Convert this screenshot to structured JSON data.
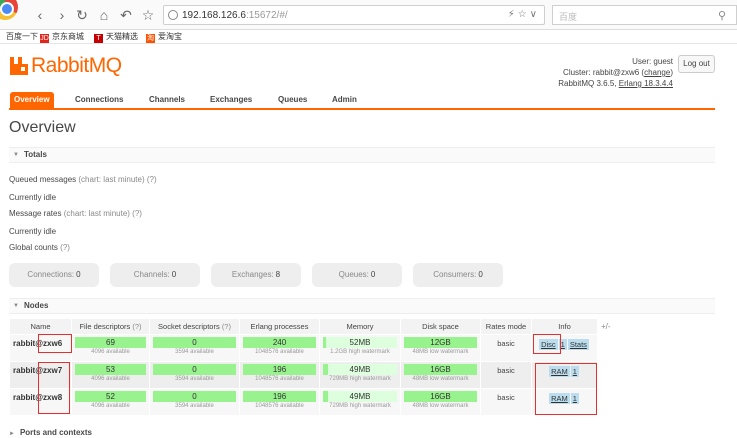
{
  "browser": {
    "url_host": "192.168.126.6",
    "url_rest": ":15672/#/",
    "search_placeholder": "百度",
    "bookmarks": [
      {
        "label": "百度一下",
        "icon": ""
      },
      {
        "label": "京东商城",
        "icon": "JD",
        "color": "#e1251b"
      },
      {
        "label": "天猫精选",
        "icon": "T",
        "color": "#c40000"
      },
      {
        "label": "爱淘宝",
        "icon": "淘",
        "color": "#ff5000"
      }
    ]
  },
  "header": {
    "logo_text": "RabbitMQ",
    "logo_tm": "TM",
    "user_line": "User: guest",
    "cluster_prefix": "Cluster: rabbit@zxw6 (",
    "cluster_link": "change",
    "cluster_suffix": ")",
    "version_prefix": "RabbitMQ 3.6.5, ",
    "erlang_link": "Erlang 18.3.4.4",
    "logout_label": "Log out"
  },
  "tabs": [
    "Overview",
    "Connections",
    "Channels",
    "Exchanges",
    "Queues",
    "Admin"
  ],
  "page_title": "Overview",
  "totals": {
    "heading": "Totals",
    "queued_label": "Queued messages",
    "queued_hint": "(chart: last minute) (?)",
    "idle1": "Currently idle",
    "rates_label": "Message rates",
    "rates_hint": "(chart: last minute) (?)",
    "idle2": "Currently idle",
    "global_label": "Global counts",
    "global_hint": "(?)"
  },
  "counts": [
    {
      "label": "Connections:",
      "value": "0"
    },
    {
      "label": "Channels:",
      "value": "0"
    },
    {
      "label": "Exchanges:",
      "value": "8"
    },
    {
      "label": "Queues:",
      "value": "0"
    },
    {
      "label": "Consumers:",
      "value": "0"
    }
  ],
  "nodes": {
    "heading": "Nodes",
    "plus_minus": "+/-",
    "columns": {
      "name": "Name",
      "fd": "File descriptors",
      "fd_hint": "(?)",
      "sd": "Socket descriptors",
      "sd_hint": "(?)",
      "ep": "Erlang processes",
      "mem": "Memory",
      "disk": "Disk space",
      "rates": "Rates mode",
      "info": "Info"
    },
    "rows": [
      {
        "name": "rabbit@zxw6",
        "fd": "69",
        "fd_sub": "4096 available",
        "sd": "0",
        "sd_sub": "3594 available",
        "ep": "240",
        "ep_sub": "1048576 available",
        "mem": "52MB",
        "mem_fill": 0.04,
        "mem_sub": "1.2GB high watermark",
        "disk": "12GB",
        "disk_sub": "48MB low watermark",
        "rates": "basic",
        "info": [
          "Disc",
          "1",
          "Stats"
        ]
      },
      {
        "name": "rabbit@zxw7",
        "fd": "53",
        "fd_sub": "4096 available",
        "sd": "0",
        "sd_sub": "3594 available",
        "ep": "196",
        "ep_sub": "1048576 available",
        "mem": "49MB",
        "mem_fill": 0.07,
        "mem_sub": "729MB high watermark",
        "disk": "16GB",
        "disk_sub": "48MB low watermark",
        "rates": "basic",
        "info": [
          "RAM",
          "1"
        ]
      },
      {
        "name": "rabbit@zxw8",
        "fd": "52",
        "fd_sub": "4096 available",
        "sd": "0",
        "sd_sub": "3594 available",
        "ep": "196",
        "ep_sub": "1048576 available",
        "mem": "49MB",
        "mem_fill": 0.07,
        "mem_sub": "729MB high watermark",
        "disk": "16GB",
        "disk_sub": "48MB low watermark",
        "rates": "basic",
        "info": [
          "RAM",
          "1"
        ]
      }
    ]
  },
  "ports_heading": "Ports and contexts"
}
